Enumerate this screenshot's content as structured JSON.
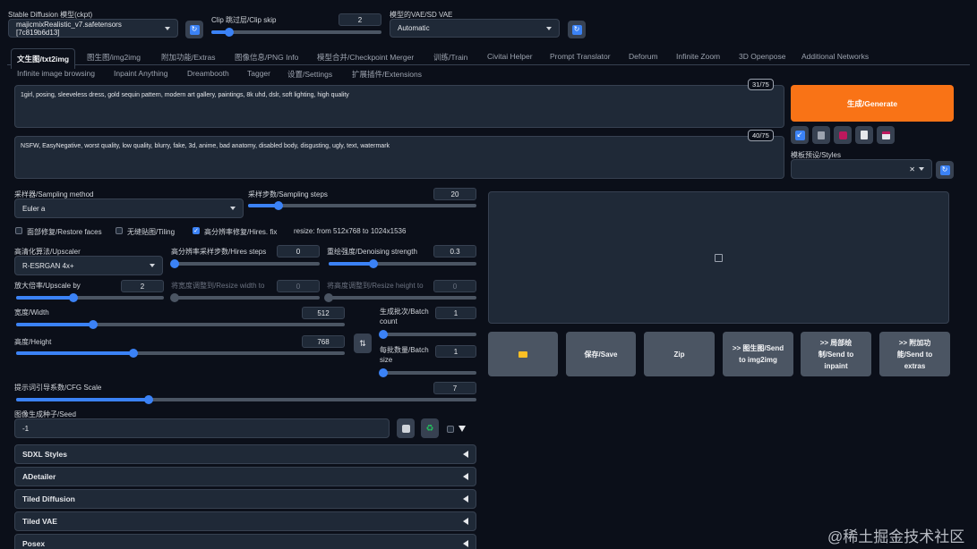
{
  "header": {
    "checkpoint_label": "Stable Diffusion 模型(ckpt)",
    "checkpoint_value": "majicmixRealistic_v7.safetensors [7c819b6d13]",
    "clip_skip_label": "Clip 跳过层/Clip skip",
    "clip_skip_value": "2",
    "vae_label": "模型的VAE/SD VAE",
    "vae_value": "Automatic"
  },
  "tabs_row1": [
    "文生图/txt2img",
    "图生图/img2img",
    "附加功能/Extras",
    "图像信息/PNG Info",
    "模型合并/Checkpoint Merger",
    "训练/Train",
    "Civitai Helper",
    "Prompt Translator",
    "Deforum",
    "Infinite Zoom",
    "3D Openpose",
    "Additional Networks"
  ],
  "tabs_row2": [
    "Infinite image browsing",
    "Inpaint Anything",
    "Dreambooth",
    "Tagger",
    "设置/Settings",
    "扩展插件/Extensions"
  ],
  "prompt": {
    "positive": "1girl, posing, sleeveless dress, gold sequin pattern, modern art gallery, paintings, 8k uhd, dslr, soft lighting, high quality",
    "positive_count": "31/75",
    "negative": "NSFW, EasyNegative, worst quality, low quality, blurry, fake, 3d, anime, bad anatomy, disabled body, disgusting, ugly, text, watermark",
    "negative_count": "40/75"
  },
  "generate_label": "生成/Generate",
  "styles_label": "模板预设/Styles",
  "sampling": {
    "method_label": "采样器/Sampling method",
    "method_value": "Euler a",
    "steps_label": "采样步数/Sampling steps",
    "steps_value": "20",
    "steps_fraction": 0.13
  },
  "options": {
    "restore_faces": "面部修复/Restore faces",
    "tiling": "无缝贴图/Tiling",
    "hires_fix": "高分辨率修复/Hires. fix",
    "resize_info": "resize: from 512x768 to 1024x1536"
  },
  "hires": {
    "upscaler_label": "高清化算法/Upscaler",
    "upscaler_value": "R-ESRGAN 4x+",
    "hires_steps_label": "高分辨率采样步数/Hires steps",
    "hires_steps_value": "0",
    "denoise_label": "重绘强度/Denoising strength",
    "denoise_value": "0.3",
    "upscale_by_label": "放大倍率/Upscale by",
    "upscale_by_value": "2",
    "resize_w_label": "将宽度调整到/Resize width to",
    "resize_w_value": "0",
    "resize_h_label": "将高度调整到/Resize height to",
    "resize_h_value": "0"
  },
  "dims": {
    "width_label": "宽度/Width",
    "width_value": "512",
    "height_label": "高度/Height",
    "height_value": "768",
    "batch_count_label": "生成批次/Batch count",
    "batch_count_value": "1",
    "batch_size_label": "每批数量/Batch size",
    "batch_size_value": "1"
  },
  "cfg": {
    "label": "提示词引导系数/CFG Scale",
    "value": "7"
  },
  "seed": {
    "label": "图像生成种子/Seed",
    "value": "-1"
  },
  "accordions": [
    "SDXL Styles",
    "ADetailer",
    "Tiled Diffusion",
    "Tiled VAE",
    "Posex"
  ],
  "actions": {
    "save": "保存/Save",
    "zip": "Zip",
    "send_img2img": ">> 图生图/Send to img2img",
    "send_inpaint": ">> 局部绘制/Send to inpaint",
    "send_extras": ">> 附加功能/Send to extras"
  },
  "watermark": "@稀土掘金技术社区",
  "colors": {
    "accent": "#3b82f6",
    "generate": "#f97316",
    "background": "#0b0f19"
  }
}
